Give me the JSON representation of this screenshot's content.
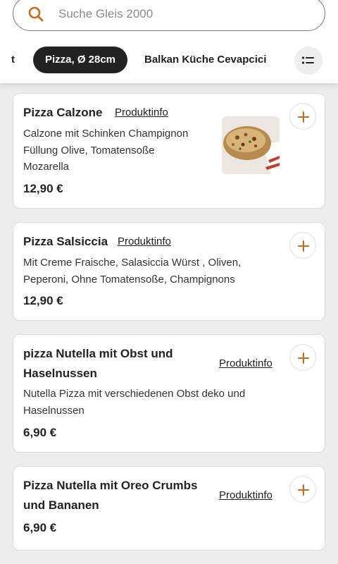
{
  "search": {
    "placeholder": "Suche Gleis 2000",
    "icon": "search-icon"
  },
  "categories": {
    "cut_label": "t",
    "active_label": "Pizza, Ø 28cm",
    "next_label": "Balkan Küche Cevapcici",
    "menu_icon": "list-icon"
  },
  "products": [
    {
      "title": "Pizza Calzone",
      "info_label": "Produktinfo",
      "description_lines": [
        "Calzone mit Schinken Champignon",
        "Füllung Olive, Tomatensoße",
        "Mozarella"
      ],
      "price": "12,90 €",
      "has_image": true
    },
    {
      "title": "Pizza Salsiccia",
      "info_label": "Produktinfo",
      "description_lines": [
        "Mit Creme Fraische, Salasiccia Würst , Oliven,",
        "Peperoni, Ohne Tomatensoße, Champignons"
      ],
      "price": "12,90 €"
    },
    {
      "title_lines": [
        "pizza Nutella mit Obst und",
        "Haselnussen"
      ],
      "info_label": "Produktinfo",
      "description_lines": [
        "Nutella Pizza mit verschiedenen Obst deko und",
        "Haselnussen"
      ],
      "price": "6,90 €"
    },
    {
      "title_lines": [
        "Pizza Nutella mit Oreo Crumbs",
        "und Bananen"
      ],
      "info_label": "Produktinfo",
      "price": "6,90 €"
    }
  ],
  "colors": {
    "accent": "#c96a1b",
    "dark_pill": "#222222",
    "card_border": "#dcdcdc",
    "background": "#ececec"
  }
}
